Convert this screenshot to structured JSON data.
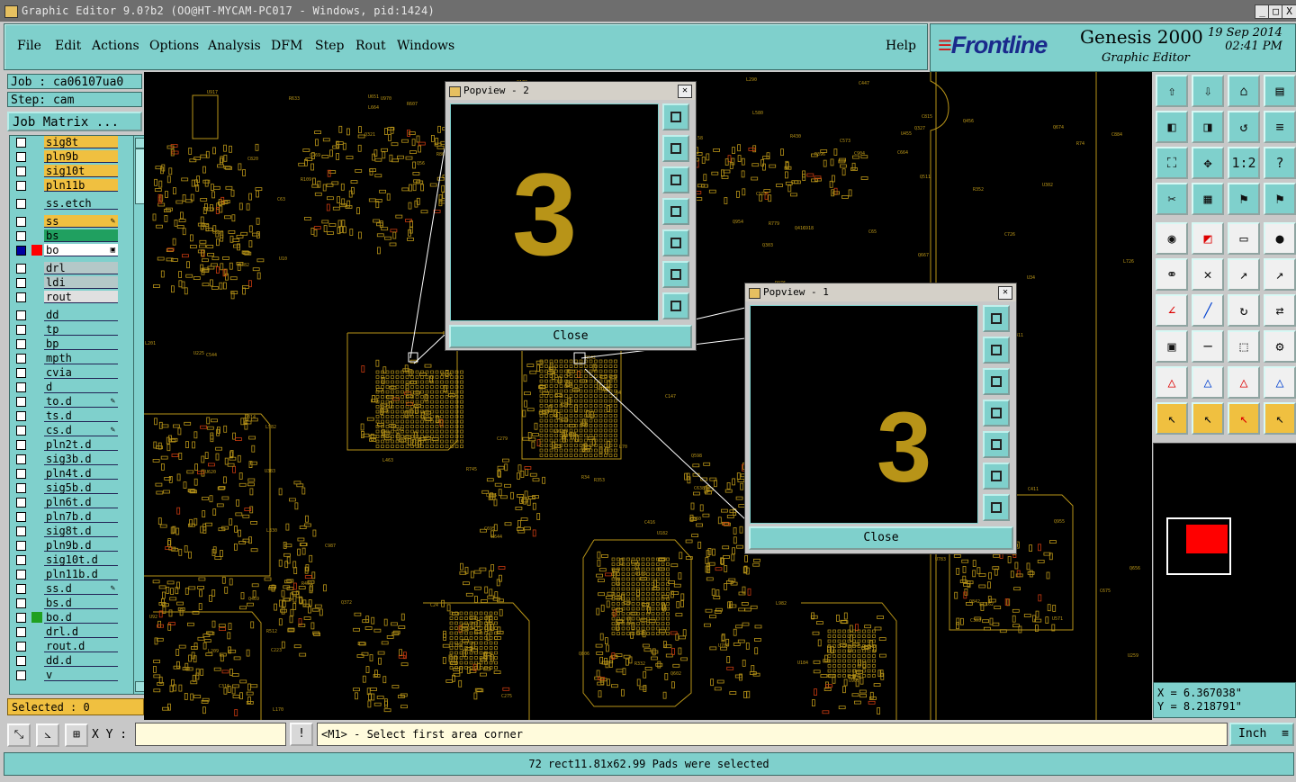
{
  "window": {
    "title": "Graphic Editor 9.0?b2 (OO@HT-MYCAM-PC017 - Windows, pid:1424)",
    "min": "_",
    "max": "□",
    "close": "X"
  },
  "menu": {
    "items": [
      "File",
      "Edit",
      "Actions",
      "Options",
      "Analysis",
      "DFM",
      "Step",
      "Rout",
      "Windows"
    ],
    "help": "Help"
  },
  "brand": {
    "logo_main": "Frontline",
    "product": "Genesis 2000",
    "module": "Graphic Editor",
    "date": "19 Sep 2014",
    "time": "02:41 PM"
  },
  "job": {
    "job_line": "Job : ca06107ua0",
    "step_line": "Step: cam",
    "matrix_button": "Job Matrix ..."
  },
  "layers": [
    {
      "name": "sig8t",
      "color": "#f0c040"
    },
    {
      "name": "pln9b",
      "color": "#f0c040"
    },
    {
      "name": "sig10t",
      "color": "#f0c040"
    },
    {
      "name": "pln11b",
      "color": "#f0c040"
    },
    {
      "name": "ss.etch",
      "color": "#7fd0cc"
    },
    {
      "name": "ss",
      "color": "#f0c040",
      "flag": "✎"
    },
    {
      "name": "bs",
      "color": "#20a060"
    },
    {
      "name": "bo",
      "color": "#ffffff",
      "flag": "▣",
      "active": true
    },
    {
      "name": "drl",
      "color": "#b4c8c8"
    },
    {
      "name": "ldi",
      "color": "#b4c8c8"
    },
    {
      "name": "rout",
      "color": "#e0e0e0"
    },
    {
      "name": "dd",
      "color": "#7fd0cc"
    },
    {
      "name": "tp",
      "color": "#7fd0cc"
    },
    {
      "name": "bp",
      "color": "#7fd0cc"
    },
    {
      "name": "mpth",
      "color": "#7fd0cc"
    },
    {
      "name": "cvia",
      "color": "#7fd0cc"
    },
    {
      "name": "d",
      "color": "#7fd0cc"
    },
    {
      "name": "to.d",
      "color": "#7fd0cc",
      "flag": "✎"
    },
    {
      "name": "ts.d",
      "color": "#7fd0cc"
    },
    {
      "name": "cs.d",
      "color": "#7fd0cc",
      "flag": "✎"
    },
    {
      "name": "pln2t.d",
      "color": "#7fd0cc"
    },
    {
      "name": "sig3b.d",
      "color": "#7fd0cc"
    },
    {
      "name": "pln4t.d",
      "color": "#7fd0cc"
    },
    {
      "name": "sig5b.d",
      "color": "#7fd0cc"
    },
    {
      "name": "pln6t.d",
      "color": "#7fd0cc"
    },
    {
      "name": "pln7b.d",
      "color": "#7fd0cc"
    },
    {
      "name": "sig8t.d",
      "color": "#7fd0cc"
    },
    {
      "name": "pln9b.d",
      "color": "#7fd0cc"
    },
    {
      "name": "sig10t.d",
      "color": "#7fd0cc"
    },
    {
      "name": "pln11b.d",
      "color": "#7fd0cc"
    },
    {
      "name": "ss.d",
      "color": "#7fd0cc",
      "flag": "✎"
    },
    {
      "name": "bs.d",
      "color": "#7fd0cc"
    },
    {
      "name": "bo.d",
      "color": "#7fd0cc",
      "mark": "#20a020"
    },
    {
      "name": "drl.d",
      "color": "#7fd0cc"
    },
    {
      "name": "rout.d",
      "color": "#7fd0cc"
    },
    {
      "name": "dd.d",
      "color": "#7fd0cc"
    },
    {
      "name": "v",
      "color": "#7fd0cc"
    }
  ],
  "selected_text": "Selected : 0",
  "popups": [
    {
      "title": "Popview - 2",
      "glyph": "3",
      "close": "Close"
    },
    {
      "title": "Popview - 1",
      "glyph": "3",
      "close": "Close"
    }
  ],
  "coords": {
    "x": "X = 6.367038\"",
    "y": "Y = 8.218791\""
  },
  "command": {
    "xy_label": "X Y :",
    "xy_value": "",
    "bang": "!",
    "prompt": "<M1> - Select first area corner",
    "unit": "Inch"
  },
  "status": "72 rect11.81x62.99 Pads were selected",
  "colors": {
    "accent": "#7fd0cc",
    "trace": "#b89418",
    "highlight": "#f0c040"
  },
  "right_tools": [
    "house-up",
    "house-down",
    "home",
    "window",
    "pan-left",
    "pan-right",
    "undo-zoom",
    "scale",
    "fit",
    "zoom-center",
    "ratio-1-2",
    "query",
    "measure",
    "grid",
    "layer-tools-a",
    "layer-tools-b",
    "select-pad",
    "fill-red",
    "ruler",
    "circle",
    "connect",
    "cross",
    "add-pad",
    "add-pad-b",
    "line-red",
    "line-blue",
    "arc",
    "flip",
    "pad-move",
    "line-add",
    "box",
    "layer-swap",
    "triangle-red",
    "triangle-blue",
    "triangle-red-b",
    "triangle-blue-b",
    "pointer",
    "pointer-box",
    "pointer-red",
    "pointer-multi"
  ],
  "right_tool_labels": [
    "⇧",
    "⇩",
    "⌂",
    "▤",
    "◧",
    "◨",
    "↺",
    "≡",
    "⛶",
    "✥",
    "1:2",
    "?",
    "✂",
    "▦",
    "⚑",
    "⚑",
    "◉",
    "◩",
    "▭",
    "●",
    "⚭",
    "✕",
    "↗",
    "↗",
    "∠",
    "╱",
    "↻",
    "⇄",
    "▣",
    "─",
    "⬚",
    "⚙",
    "△",
    "△",
    "△",
    "△",
    "↖",
    "↖",
    "↖",
    "↖"
  ]
}
